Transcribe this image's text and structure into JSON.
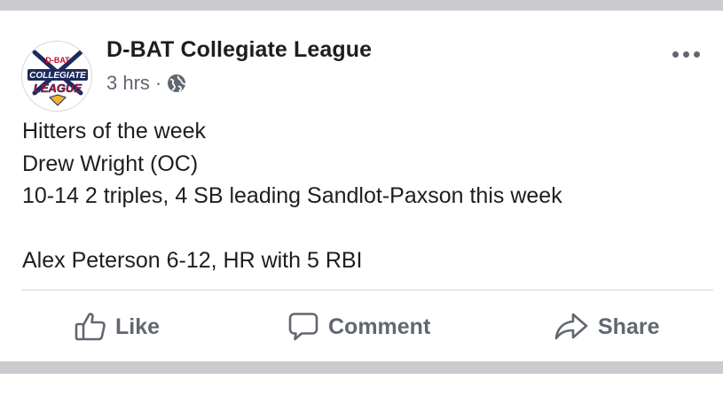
{
  "post": {
    "page_name": "D-BAT Collegiate League",
    "timestamp": "3 hrs",
    "separator": "·",
    "privacy_icon": "globe-icon",
    "avatar_logo_text": [
      "D-BAT",
      "COLLEGIATE",
      "LEAGUE"
    ],
    "lines": [
      "Hitters of the week",
      "Drew Wright (OC)",
      "10-14 2 triples, 4 SB leading Sandlot-Paxson this week",
      "",
      "Alex Peterson 6-12, HR with 5 RBI"
    ]
  },
  "actions": {
    "like_label": "Like",
    "comment_label": "Comment",
    "share_label": "Share"
  },
  "colors": {
    "text": "#1c1e21",
    "muted": "#606770",
    "divider": "#d5d6d9",
    "band": "#cacbcf",
    "logo_red": "#c8102e",
    "logo_navy": "#1d2a5c",
    "logo_gold": "#f2b22c"
  }
}
